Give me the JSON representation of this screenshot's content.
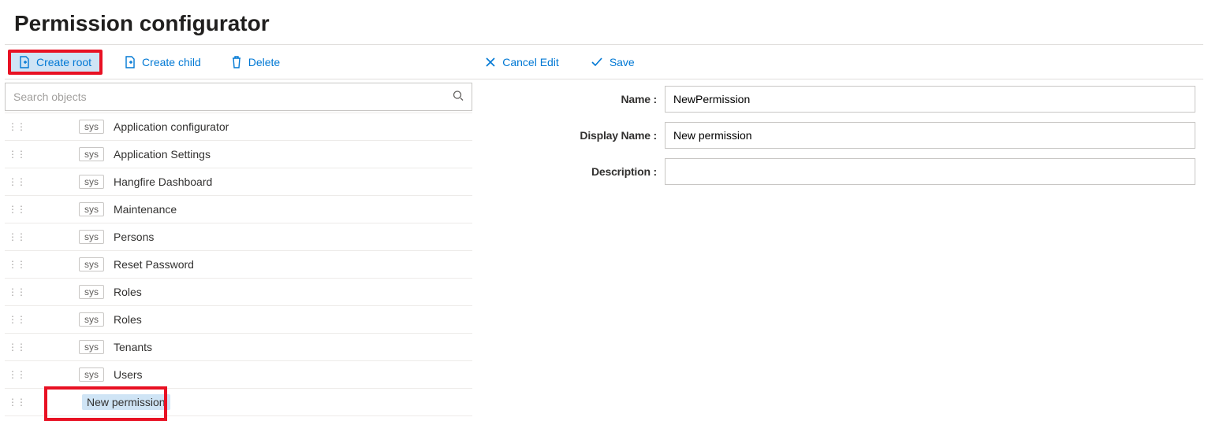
{
  "page": {
    "title": "Permission configurator"
  },
  "toolbar": {
    "createRoot": "Create root",
    "createChild": "Create child",
    "delete": "Delete",
    "cancelEdit": "Cancel Edit",
    "save": "Save"
  },
  "search": {
    "placeholder": "Search objects"
  },
  "tree": {
    "sysBadge": "sys",
    "items": [
      {
        "label": "Application configurator",
        "sys": true
      },
      {
        "label": "Application Settings",
        "sys": true
      },
      {
        "label": "Hangfire Dashboard",
        "sys": true
      },
      {
        "label": "Maintenance",
        "sys": true
      },
      {
        "label": "Persons",
        "sys": true
      },
      {
        "label": "Reset Password",
        "sys": true
      },
      {
        "label": "Roles",
        "sys": true
      },
      {
        "label": "Roles",
        "sys": true
      },
      {
        "label": "Tenants",
        "sys": true
      },
      {
        "label": "Users",
        "sys": true
      },
      {
        "label": "New permission",
        "sys": false,
        "selected": true
      }
    ]
  },
  "form": {
    "nameLabel": "Name",
    "nameValue": "NewPermission",
    "displayNameLabel": "Display Name",
    "displayNameValue": "New permission",
    "descriptionLabel": "Description",
    "descriptionValue": ""
  }
}
